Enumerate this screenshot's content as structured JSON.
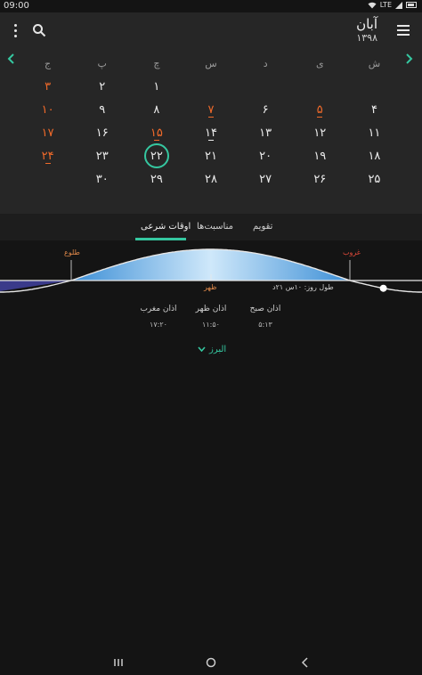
{
  "status_bar": {
    "time": "09:00",
    "network": "LTE"
  },
  "header": {
    "month": "آبان",
    "year": "۱۳۹۸"
  },
  "weekdays": [
    "ش",
    "ی",
    "د",
    "س",
    "چ",
    "پ",
    "ج"
  ],
  "days": [
    {
      "t": "",
      "c": 1
    },
    {
      "t": "",
      "c": 2
    },
    {
      "t": "",
      "c": 3
    },
    {
      "t": "",
      "c": 4
    },
    {
      "t": "۱",
      "c": 5
    },
    {
      "t": "۲",
      "c": 6
    },
    {
      "t": "۳",
      "c": 7,
      "holiday": true
    },
    {
      "t": "۴"
    },
    {
      "t": "۵",
      "holiday": true,
      "event": true
    },
    {
      "t": "۶"
    },
    {
      "t": "۷",
      "holiday": true,
      "event": true
    },
    {
      "t": "۸"
    },
    {
      "t": "۹"
    },
    {
      "t": "۱۰",
      "holiday": true
    },
    {
      "t": "۱۱"
    },
    {
      "t": "۱۲"
    },
    {
      "t": "۱۳"
    },
    {
      "t": "۱۴",
      "event": true
    },
    {
      "t": "۱۵",
      "holiday": true,
      "event": true
    },
    {
      "t": "۱۶"
    },
    {
      "t": "۱۷",
      "holiday": true
    },
    {
      "t": "۱۸"
    },
    {
      "t": "۱۹"
    },
    {
      "t": "۲۰"
    },
    {
      "t": "۲۱"
    },
    {
      "t": "۲۲",
      "today": true
    },
    {
      "t": "۲۳"
    },
    {
      "t": "۲۴",
      "holiday": true,
      "event": true
    },
    {
      "t": "۲۵"
    },
    {
      "t": "۲۶"
    },
    {
      "t": "۲۷"
    },
    {
      "t": "۲۸"
    },
    {
      "t": "۲۹"
    },
    {
      "t": "۳۰"
    },
    {
      "t": ""
    }
  ],
  "tabs": {
    "calendar": "تقویم",
    "occasions": "مناسبت‌ها",
    "prayer_times": "اوقات شرعی"
  },
  "sun_chart": {
    "sunrise_label": "طلوع",
    "noon_label": "ظهر",
    "sunset_label": "غروب",
    "day_length": "طول روز: ۱۰س ۲۱د",
    "current_progress": 1.12
  },
  "prayer_times": [
    {
      "name": "اذان صبح",
      "time": "۵:۱۳"
    },
    {
      "name": "اذان ظهر",
      "time": "۱۱:۵۰"
    },
    {
      "name": "اذان مغرب",
      "time": "۱۷:۲۰"
    }
  ],
  "location": {
    "city": "البرز"
  },
  "colors": {
    "accent": "#35c7a0",
    "holiday": "#f06a2a",
    "sunrise": "#e0894a",
    "sunset": "#e04a3a"
  }
}
